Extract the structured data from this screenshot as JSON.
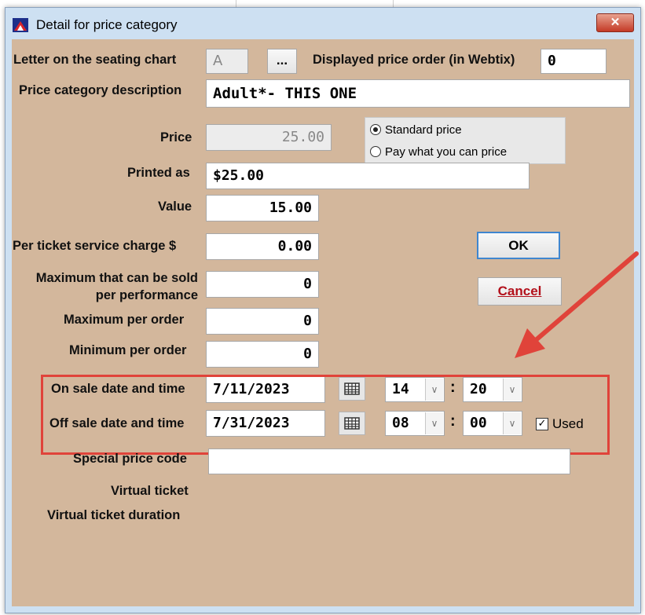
{
  "window": {
    "title": "Detail for price category",
    "close_label": "✕"
  },
  "form": {
    "seating_letter_label": "Letter on the seating chart",
    "seating_letter_value": "A",
    "ellipsis_label": "...",
    "price_order_label": "Displayed price order (in Webtix)",
    "price_order_value": "0",
    "description_label": "Price category description",
    "description_value": "Adult*- THIS ONE",
    "price_label": "Price",
    "price_value": "25.00",
    "price_options": [
      {
        "label": "Standard price",
        "selected": true
      },
      {
        "label": "Pay what you can price",
        "selected": false
      }
    ],
    "printed_as_label": "Printed as",
    "printed_as_value": "$25.00",
    "value_label": "Value",
    "value_value": "15.00",
    "service_charge_label": "Per ticket service charge $",
    "service_charge_value": "0.00",
    "max_sold_label_1": "Maximum that can be sold",
    "max_sold_label_2": "per performance",
    "max_sold_value": "0",
    "max_order_label": "Maximum per order",
    "max_order_value": "0",
    "min_order_label": "Minimum per order",
    "min_order_value": "0",
    "on_sale_label": "On sale date and time",
    "on_sale_date": "7/11/2023",
    "on_sale_hour": "14",
    "on_sale_minute": "20",
    "off_sale_label": "Off sale date and time",
    "off_sale_date": "7/31/2023",
    "off_sale_hour": "08",
    "off_sale_minute": "00",
    "colon": ":",
    "used_label": "Used",
    "used_checked": true,
    "special_code_label": "Special price code",
    "special_code_value": "",
    "virtual_ticket_label": "Virtual ticket",
    "virtual_duration_label": "Virtual ticket duration"
  },
  "buttons": {
    "ok_label": "OK",
    "cancel_label": "Cancel"
  },
  "colors": {
    "dialog_bg": "#d3b79c",
    "annotation": "#e0433a",
    "titlebar": "#cde0f2",
    "close": "#c43a26"
  },
  "icons": [
    "app-icon",
    "calendar-icon",
    "chevron-down-icon",
    "check-icon",
    "annotation-arrow"
  ]
}
